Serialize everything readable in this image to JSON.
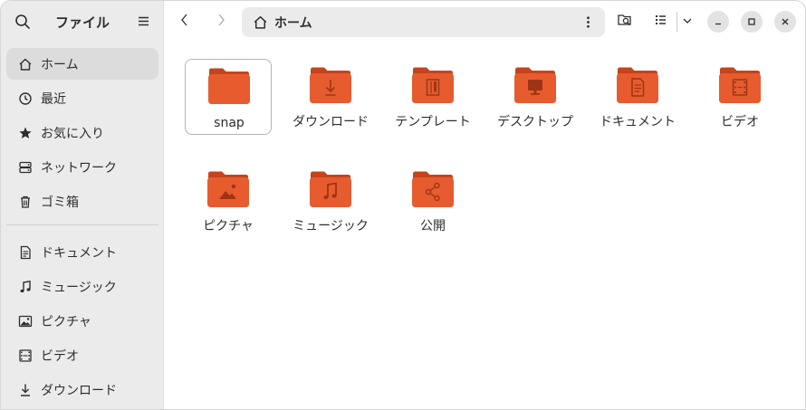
{
  "app": {
    "title": "ファイル"
  },
  "sidebar": {
    "items": [
      {
        "label": "ホーム",
        "icon": "home-icon",
        "active": true
      },
      {
        "label": "最近",
        "icon": "clock-icon"
      },
      {
        "label": "お気に入り",
        "icon": "star-icon"
      },
      {
        "label": "ネットワーク",
        "icon": "network-icon"
      },
      {
        "label": "ゴミ箱",
        "icon": "trash-icon"
      }
    ],
    "places": [
      {
        "label": "ドキュメント",
        "icon": "document-icon"
      },
      {
        "label": "ミュージック",
        "icon": "music-icon"
      },
      {
        "label": "ピクチャ",
        "icon": "picture-icon"
      },
      {
        "label": "ビデオ",
        "icon": "video-icon"
      },
      {
        "label": "ダウンロード",
        "icon": "download-icon"
      }
    ]
  },
  "pathbar": {
    "label": "ホーム"
  },
  "files": [
    {
      "name": "snap",
      "emblem": "none",
      "selected": true
    },
    {
      "name": "ダウンロード",
      "emblem": "download"
    },
    {
      "name": "テンプレート",
      "emblem": "template"
    },
    {
      "name": "デスクトップ",
      "emblem": "desktop"
    },
    {
      "name": "ドキュメント",
      "emblem": "document"
    },
    {
      "name": "ビデオ",
      "emblem": "video"
    },
    {
      "name": "ピクチャ",
      "emblem": "picture"
    },
    {
      "name": "ミュージック",
      "emblem": "music"
    },
    {
      "name": "公開",
      "emblem": "share"
    }
  ],
  "colors": {
    "folder_body": "#e65c2f",
    "folder_tab": "#c4441d",
    "emblem": "#9f3414",
    "sidebar_bg": "#ebebeb",
    "content_bg": "#ffffff"
  }
}
